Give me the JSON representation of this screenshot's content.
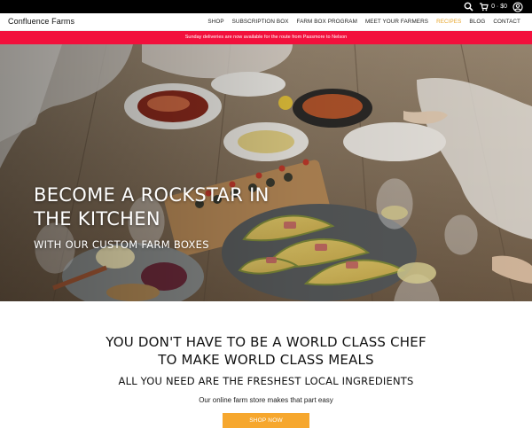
{
  "header": {
    "brand": "Confluence Farms",
    "cart_summary": "0 · $0",
    "nav": [
      {
        "label": "SHOP",
        "active": false
      },
      {
        "label": "SUBSCRIPTION BOX",
        "active": false
      },
      {
        "label": "FARM BOX PROGRAM",
        "active": false
      },
      {
        "label": "MEET YOUR FARMERS",
        "active": false
      },
      {
        "label": "RECIPES",
        "active": true
      },
      {
        "label": "BLOG",
        "active": false
      },
      {
        "label": "CONTACT",
        "active": false
      }
    ]
  },
  "announcement": "Sunday deliveries are now available for the route from Passmore to Nelson",
  "hero": {
    "title_line1": "BECOME A ROCKSTAR IN",
    "title_line2": "THE KITCHEN",
    "subtitle": "WITH OUR CUSTOM FARM BOXES"
  },
  "intro": {
    "heading_line1": "YOU DON'T HAVE TO BE A WORLD CLASS CHEF",
    "heading_line2": "TO MAKE WORLD CLASS MEALS",
    "subheading": "ALL YOU NEED ARE THE FRESHEST LOCAL INGREDIENTS",
    "body": "Our online farm store makes that part easy",
    "cta_label": "SHOP NOW"
  },
  "colors": {
    "announcement_bg": "#f2103c",
    "accent": "#e8a72f",
    "cta_bg": "#f6a72e",
    "topbar_bg": "#000000"
  },
  "icons": [
    "search-icon",
    "cart-icon",
    "account-icon"
  ]
}
